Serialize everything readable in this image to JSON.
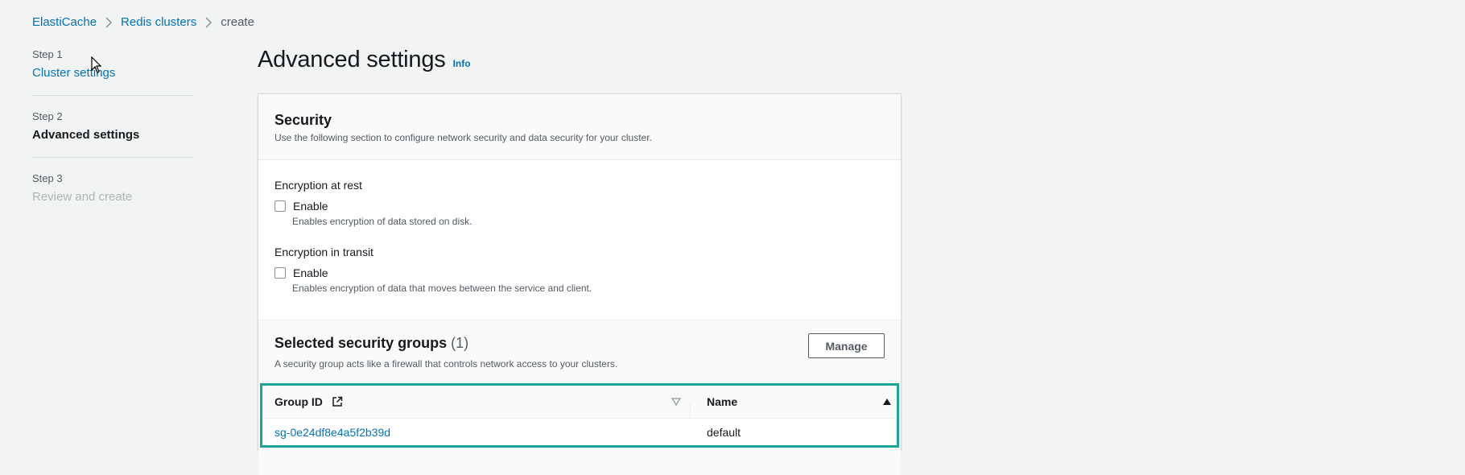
{
  "breadcrumb": {
    "items": [
      "ElastiCache",
      "Redis clusters",
      "create"
    ]
  },
  "steps": [
    {
      "number": "Step 1",
      "name": "Cluster settings"
    },
    {
      "number": "Step 2",
      "name": "Advanced settings"
    },
    {
      "number": "Step 3",
      "name": "Review and create"
    }
  ],
  "page": {
    "title": "Advanced settings",
    "info_label": "Info"
  },
  "security": {
    "title": "Security",
    "description": "Use the following section to configure network security and data security for your cluster.",
    "encryption_at_rest": {
      "label": "Encryption at rest",
      "checkbox_label": "Enable",
      "description": "Enables encryption of data stored on disk."
    },
    "encryption_in_transit": {
      "label": "Encryption in transit",
      "checkbox_label": "Enable",
      "description": "Enables encryption of data that moves between the service and client."
    }
  },
  "security_groups": {
    "title": "Selected security groups",
    "count": "(1)",
    "description": "A security group acts like a firewall that controls network access to your clusters.",
    "manage_label": "Manage",
    "columns": [
      "Group ID",
      "Name"
    ],
    "rows": [
      {
        "group_id": "sg-0e24df8e4a5f2b39d",
        "name": "default"
      }
    ]
  },
  "colors": {
    "link": "#0073bb",
    "highlight_border": "#1ba594",
    "background": "#f2f3f3"
  }
}
